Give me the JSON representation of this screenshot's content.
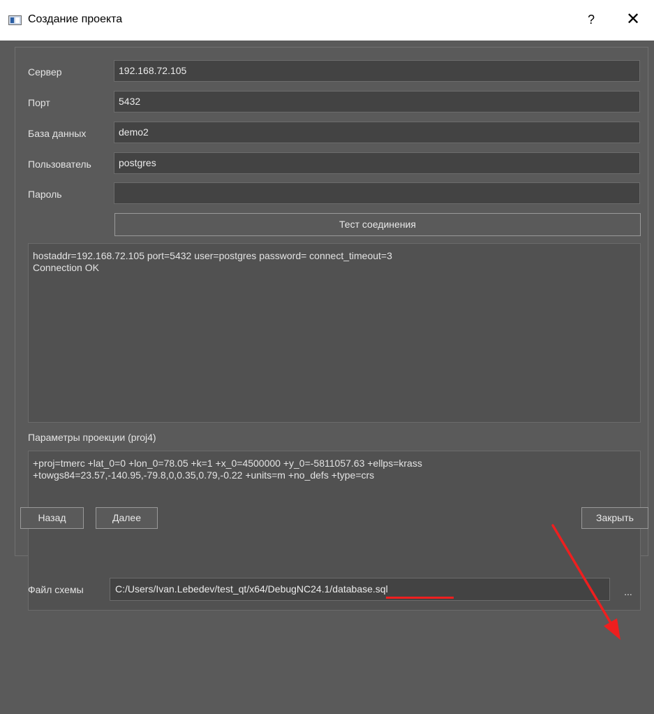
{
  "window": {
    "title": "Создание проекта",
    "help_label": "?",
    "close_label": "✕",
    "icon": "window-app-icon"
  },
  "form": {
    "server": {
      "label": "Сервер",
      "value": "192.168.72.105"
    },
    "port": {
      "label": "Порт",
      "value": "5432"
    },
    "database": {
      "label": "База данных",
      "value": "demo2"
    },
    "user": {
      "label": "Пользователь",
      "value": "postgres"
    },
    "password": {
      "label": "Пароль",
      "value": ""
    }
  },
  "test_button": {
    "label": "Тест соединения"
  },
  "connection_log": "hostaddr=192.168.72.105 port=5432 user=postgres password= connect_timeout=3\nConnection OK",
  "projection": {
    "label": "Параметры проекции (proj4)",
    "value": "+proj=tmerc +lat_0=0 +lon_0=78.05 +k=1 +x_0=4500000 +y_0=-5811057.63 +ellps=krass\n+towgs84=23.57,-140.95,-79.8,0,0.35,0.79,-0.22 +units=m +no_defs +type=crs"
  },
  "schema_file": {
    "label": "Файл схемы",
    "value": "C:/Users/Ivan.Lebedev/test_qt/x64/DebugNC24.1/database.sql",
    "browse_label": "..."
  },
  "footer": {
    "back_label": "Назад",
    "next_label": "Далее",
    "close_label": "Закрыть"
  },
  "colors": {
    "background": "#5a5a5a",
    "field": "#434343",
    "annotation": "#ee1f1f"
  }
}
